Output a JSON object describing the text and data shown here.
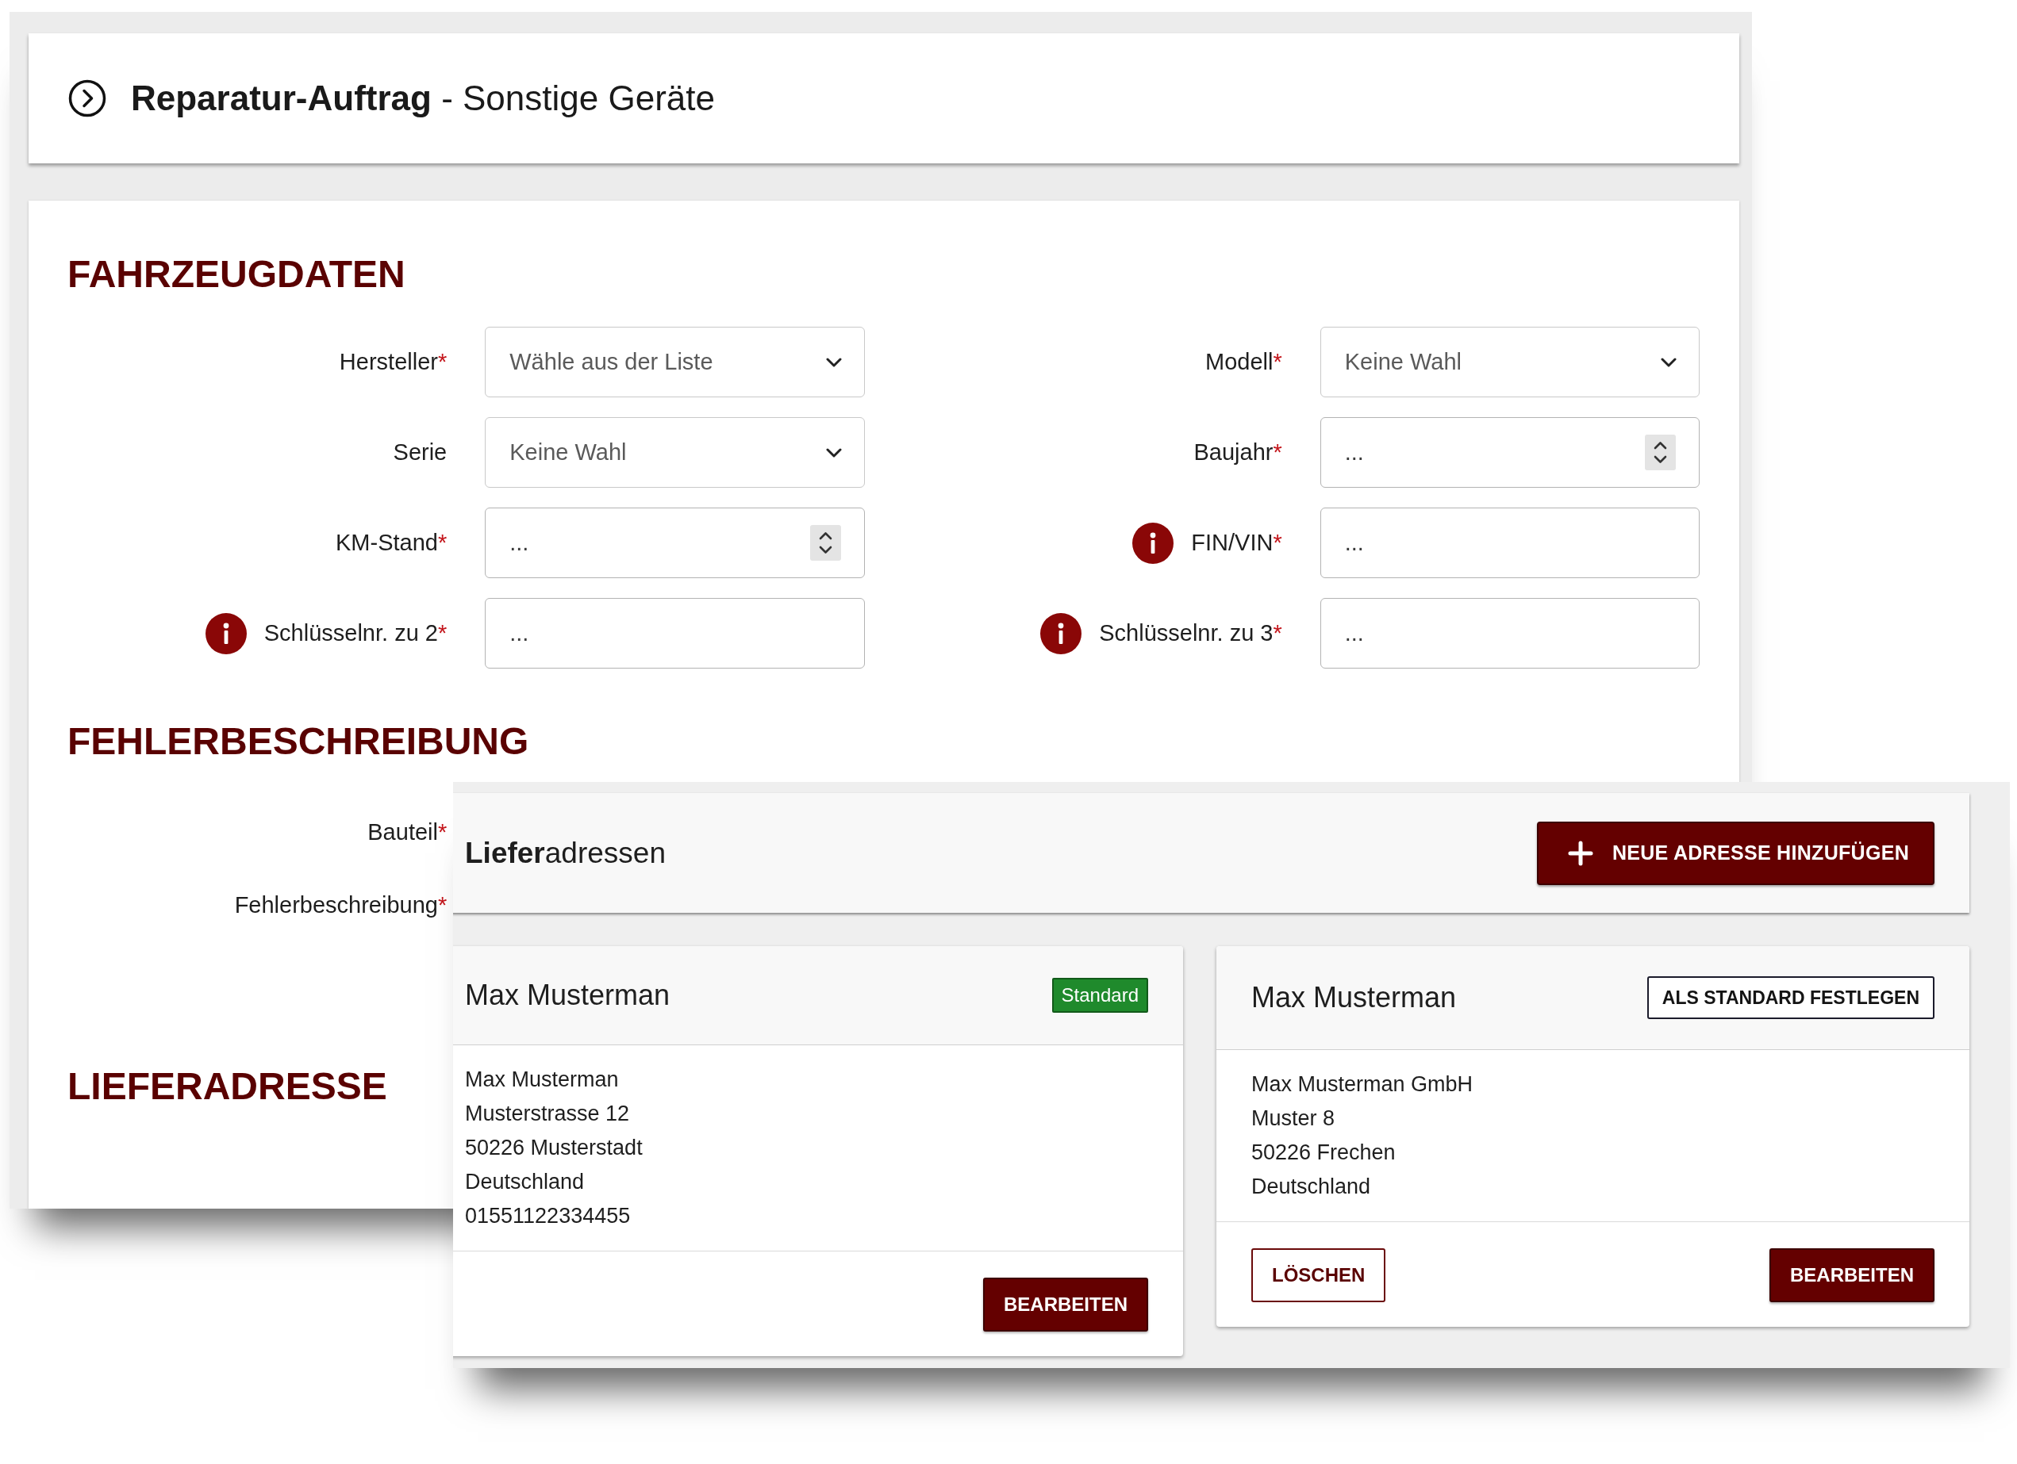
{
  "header": {
    "title": "**Reparatur-Auftrag** - Sonstige Geräte"
  },
  "required_mark": "*",
  "sections": [
    {
      "heading": "FAHRZEUGDATEN",
      "fields": [
        {
          "label": "Hersteller",
          "required": true,
          "info": false,
          "kind": "select",
          "value": "Wähle aus der Liste"
        },
        {
          "label": "Modell",
          "required": true,
          "info": false,
          "kind": "select",
          "value": "Keine Wahl"
        },
        {
          "label": "Serie",
          "required": false,
          "info": false,
          "kind": "select",
          "value": "Keine Wahl"
        },
        {
          "label": "Baujahr",
          "required": true,
          "info": false,
          "kind": "number",
          "placeholder": "..."
        },
        {
          "label": "KM-Stand",
          "required": true,
          "info": false,
          "kind": "number",
          "placeholder": "..."
        },
        {
          "label": "FIN/VIN",
          "required": true,
          "info": true,
          "kind": "text",
          "placeholder": "..."
        },
        {
          "label": "Schlüsselnr. zu 2",
          "required": true,
          "info": true,
          "kind": "text",
          "placeholder": "..."
        },
        {
          "label": "Schlüsselnr. zu 3",
          "required": true,
          "info": true,
          "kind": "text",
          "placeholder": "..."
        }
      ]
    },
    {
      "heading": "FEHLERBESCHREIBUNG",
      "fields": [
        {
          "label": "Bauteil",
          "required": true,
          "info": false
        },
        {
          "label": "Fehlerbeschreibung",
          "required": true,
          "info": false
        }
      ]
    },
    {
      "heading": "LIEFERADRESSE"
    }
  ],
  "address_panel": {
    "title": "**Liefer**adressen",
    "add_button": "NEUE ADRESSE HINZUFÜGEN",
    "addresses": [
      {
        "name": "Max Musterman",
        "default": true,
        "default_label": "Standard",
        "lines": [
          "Max Musterman",
          "Musterstrasse 12",
          "50226 Musterstadt",
          "Deutschland",
          "01551122334455"
        ],
        "actions": [
          {
            "kind": "edit",
            "label": "BEARBEITEN"
          }
        ]
      },
      {
        "name": "Max Musterman",
        "default": false,
        "default_label": "ALS STANDARD FESTLEGEN",
        "lines": [
          "Max Musterman GmbH",
          "Muster 8",
          "50226 Frechen",
          "Deutschland"
        ],
        "actions": [
          {
            "kind": "delete",
            "label": "LÖSCHEN"
          },
          {
            "kind": "edit",
            "label": "BEARBEITEN"
          }
        ]
      }
    ]
  }
}
